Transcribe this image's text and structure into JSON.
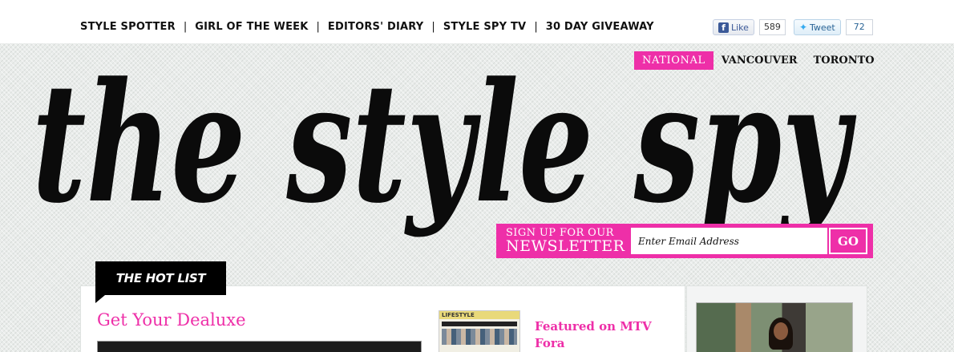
{
  "top_nav": {
    "items": [
      "STYLE SPOTTER",
      "GIRL OF THE WEEK",
      "EDITORS' DIARY",
      "STYLE SPY TV",
      "30 DAY GIVEAWAY"
    ],
    "separator": "|"
  },
  "social": {
    "like_label": "Like",
    "like_count": "589",
    "tweet_label": "Tweet",
    "tweet_count": "72"
  },
  "regions": {
    "items": [
      "NATIONAL",
      "VANCOUVER",
      "TORONTO"
    ],
    "active": "NATIONAL"
  },
  "logo": {
    "text": "the style spy"
  },
  "newsletter": {
    "line1": "SIGN UP FOR OUR",
    "line2": "NEWSLETTER",
    "placeholder": "Enter Email Address",
    "button": "GO"
  },
  "hot_list": {
    "label": "THE HOT LIST"
  },
  "main": {
    "post_title": "Get Your Dealuxe",
    "featured": {
      "title": "Featured on MTV Fora",
      "thumb_label": "LIFESTYLE"
    }
  },
  "colors": {
    "accent": "#ee2fa8",
    "text": "#111111"
  },
  "icons": [
    "facebook-icon",
    "twitter-icon"
  ]
}
